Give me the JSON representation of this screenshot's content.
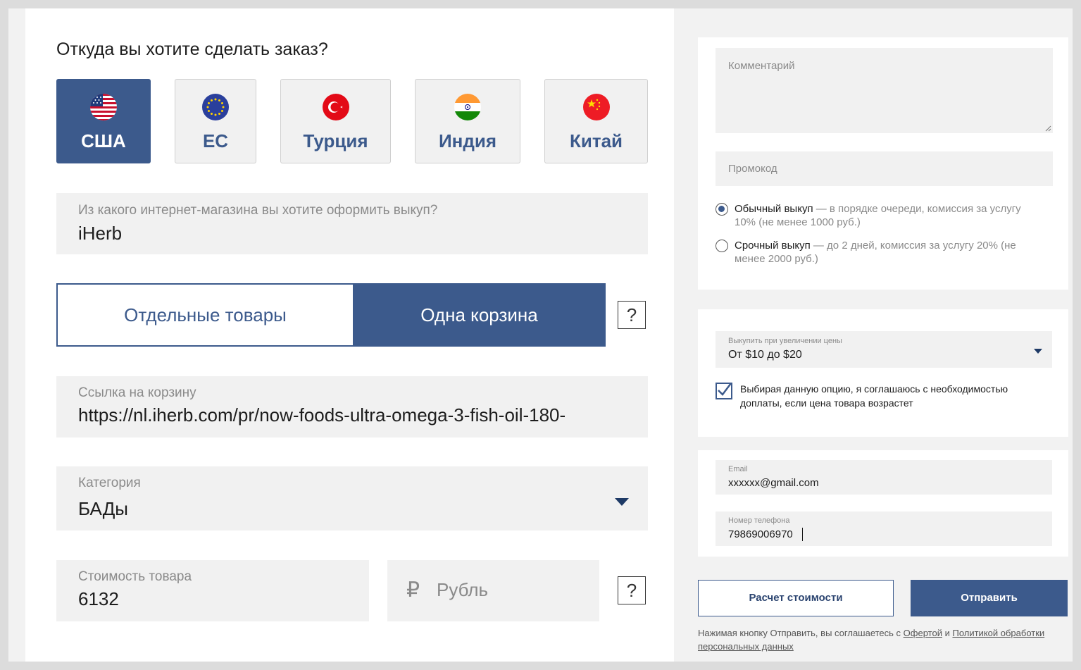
{
  "order_form": {
    "question": "Откуда вы хотите сделать заказ?",
    "countries": [
      {
        "label": "США",
        "flag": "us-flag-icon",
        "selected": true
      },
      {
        "label": "ЕС",
        "flag": "eu-flag-icon",
        "selected": false
      },
      {
        "label": "Турция",
        "flag": "turkey-flag-icon",
        "selected": false
      },
      {
        "label": "Индия",
        "flag": "india-flag-icon",
        "selected": false
      },
      {
        "label": "Китай",
        "flag": "china-flag-icon",
        "selected": false
      }
    ],
    "store": {
      "label": "Из какого интернет-магазина вы хотите оформить выкуп?",
      "value": "iHerb"
    },
    "mode_toggle": {
      "option_1": "Отдельные товары",
      "option_2": "Одна корзина",
      "selected": "Одна корзина",
      "help": "?"
    },
    "cart_link": {
      "label": "Ссылка на корзину",
      "value": "https://nl.iherb.com/pr/now-foods-ultra-omega-3-fish-oil-180-"
    },
    "category": {
      "label": "Категория",
      "value": "БАДы"
    },
    "price": {
      "label": "Стоимость товара",
      "value": "6132",
      "help": "?"
    },
    "currency": {
      "symbol": "₽",
      "value": "Рубль"
    }
  },
  "sidebar": {
    "comment_placeholder": "Комментарий",
    "promo_placeholder": "Промокод",
    "buyout_options": [
      {
        "title": "Обычный выкуп",
        "desc": " — в порядке очереди, комиссия за услугу 10% (не менее 1000 руб.)",
        "selected": true
      },
      {
        "title": "Срочный выкуп",
        "desc": " — до 2 дней, комиссия за услугу 20% (не менее 2000 руб.)",
        "selected": false
      }
    ],
    "price_increase": {
      "label": "Выкупить при увеличении цены",
      "value": "От $10 до $20"
    },
    "agree": {
      "text": "Выбирая данную опцию, я соглашаюсь с необходимостью доплаты, если цена товара возрастет",
      "checked": true
    },
    "email": {
      "label": "Email",
      "value": "xxxxxx@gmail.com"
    },
    "phone": {
      "label": "Номер телефона",
      "value": "79869006970"
    },
    "calc_button": "Расчет стоимости",
    "submit_button": "Отправить",
    "legal": {
      "prefix": "Нажимая кнопку Отправить, вы соглашаетесь с ",
      "offer": "Офертой",
      "and": " и ",
      "policy": "Политикой обработки персональных данных"
    }
  },
  "colors": {
    "accent": "#3c5a8c",
    "field_bg": "#f1f1f1",
    "page_bg": "#dcdcdc"
  }
}
